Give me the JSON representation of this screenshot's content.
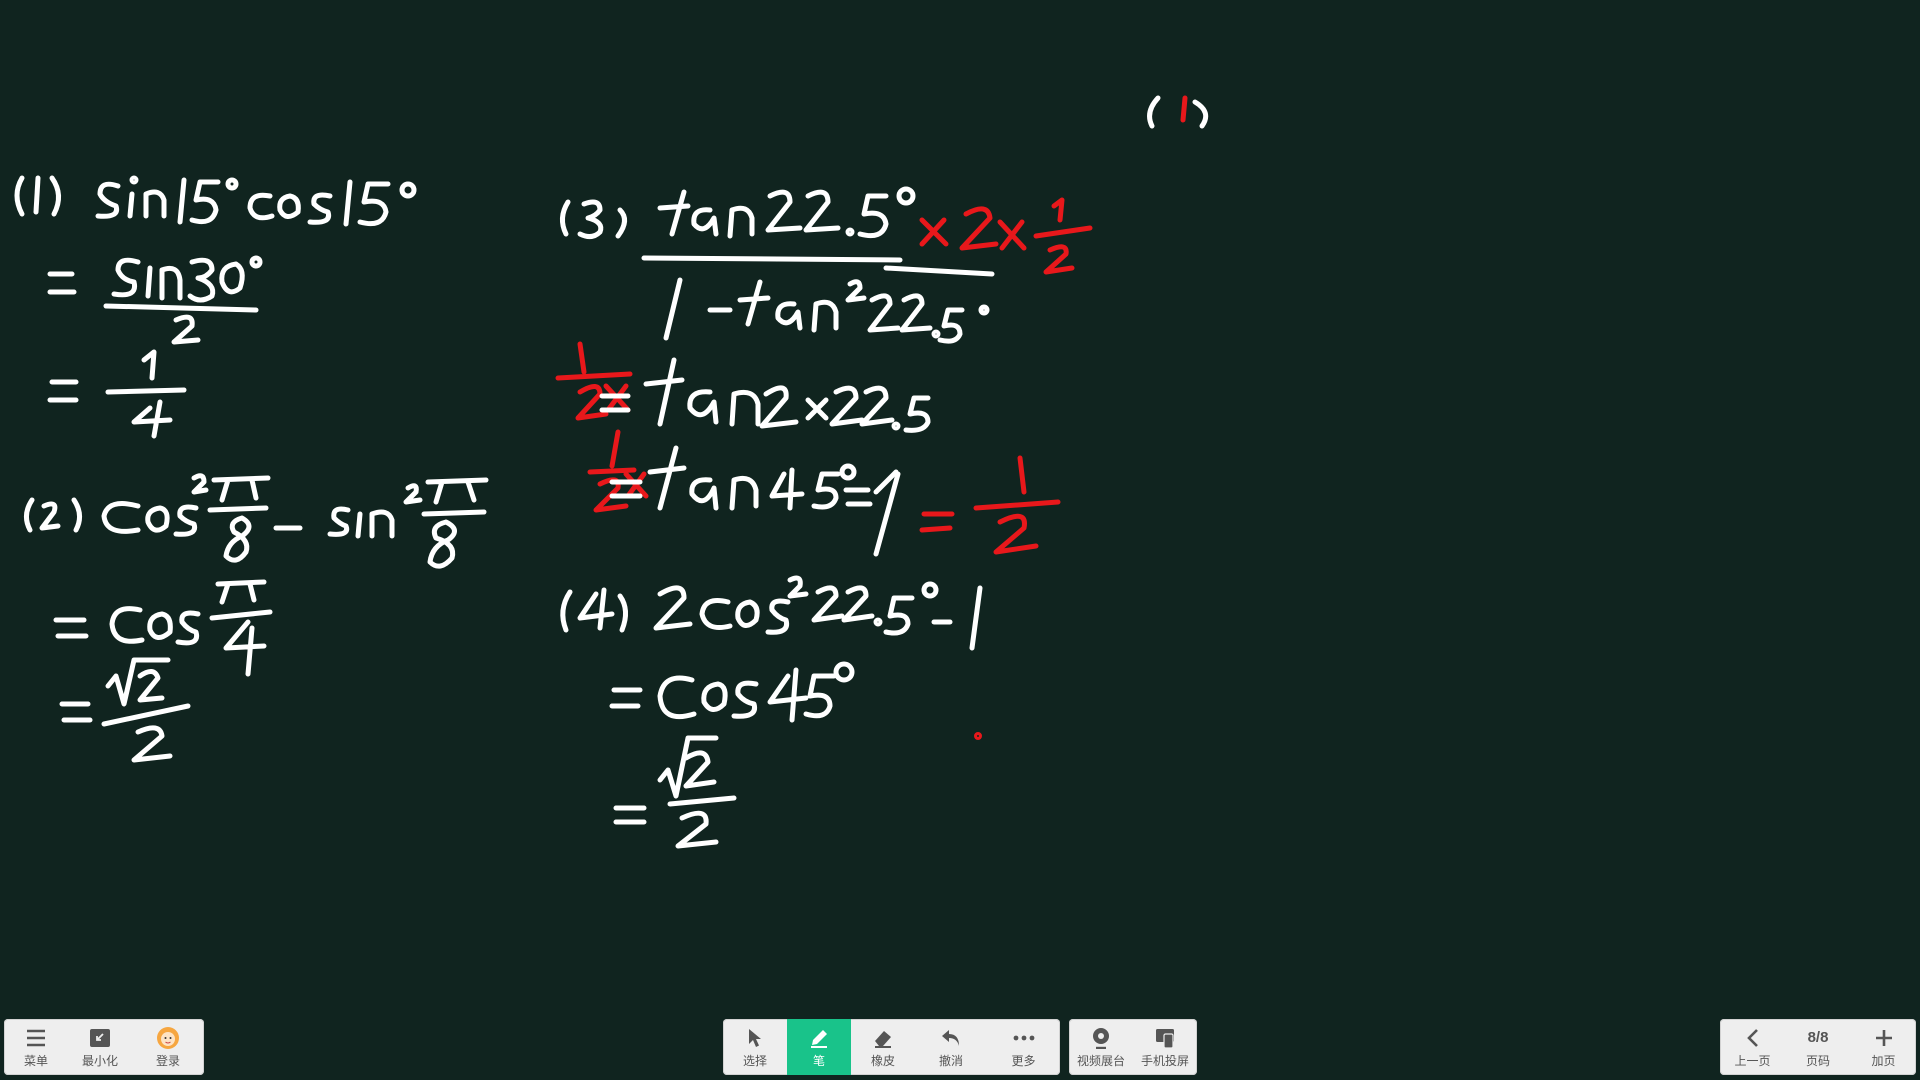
{
  "left_toolbar": {
    "menu_label": "菜单",
    "minimize_label": "最小化",
    "login_label": "登录"
  },
  "center_toolbar": {
    "select_label": "选择",
    "pen_label": "笔",
    "eraser_label": "橡皮",
    "undo_label": "撤消",
    "more_label": "更多"
  },
  "media_toolbar": {
    "video_booth_label": "视频展台",
    "phone_cast_label": "手机投屏"
  },
  "page_nav": {
    "prev_label": "上一页",
    "page_indicator": "8/8",
    "page_label": "页码",
    "add_page_label": "加页"
  },
  "colors": {
    "board": "#10241f",
    "ink_white": "#ffffff",
    "ink_red": "#e8181b",
    "active_tool": "#19c38a"
  }
}
